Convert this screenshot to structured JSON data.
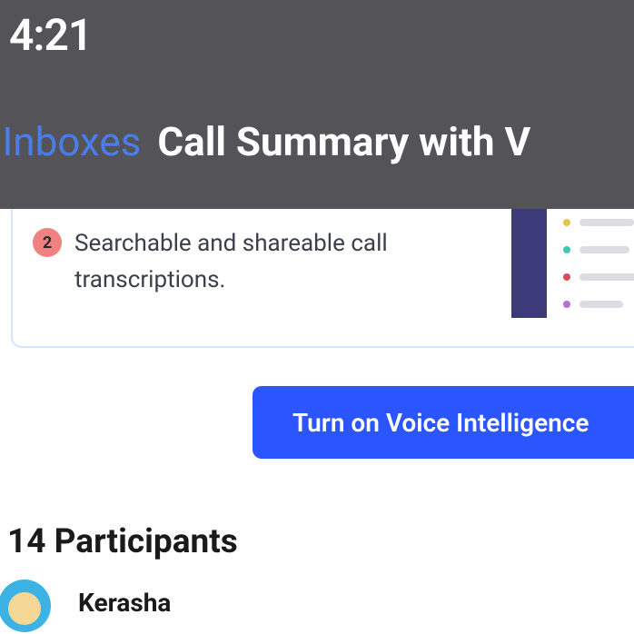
{
  "status": {
    "time": "4:21"
  },
  "nav": {
    "back_label": "ll Inboxes",
    "title": "Call Summary with V"
  },
  "feature": {
    "badge_number": "2",
    "text": "Searchable and shareable call transcriptions."
  },
  "graphic": {
    "dots": [
      {
        "color": "#e8c14b",
        "line_width": 60
      },
      {
        "color": "#3fc9b0",
        "line_width": 55
      },
      {
        "color": "#d94a5a",
        "line_width": 70
      },
      {
        "color": "#b56fd6",
        "line_width": 48
      }
    ]
  },
  "cta": {
    "label": "Turn on Voice Intelligence"
  },
  "participants": {
    "heading": "14 Participants",
    "items": [
      {
        "name": "Kerasha"
      }
    ]
  }
}
